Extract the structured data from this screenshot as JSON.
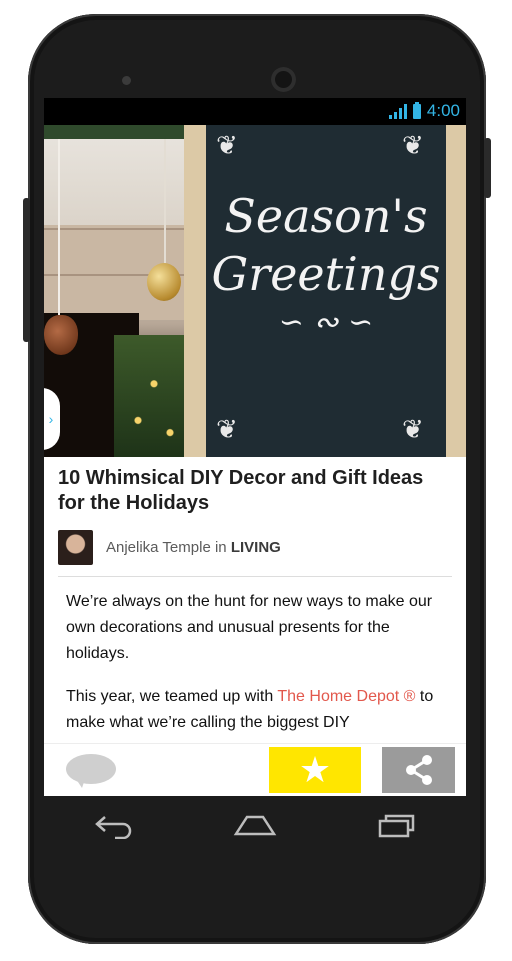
{
  "status_bar": {
    "time": "4:00",
    "signal_icon": "signal-icon",
    "battery_icon": "battery-icon",
    "accent_color": "#33b5e5"
  },
  "hero": {
    "image_text_line1": "Season's",
    "image_text_line2": "Greetings",
    "side_tab_icon": "chevron-right-icon"
  },
  "article": {
    "title": "10 Whimsical DIY Decor and Gift Ideas for the Holidays",
    "author": "Anjelika Temple",
    "in_word": "in",
    "category": "LIVING",
    "paragraph1": "We’re always on the hunt for new ways to make our own decorations and unusual presents for the holidays.",
    "paragraph2_prefix": "This year, we teamed up with ",
    "paragraph2_link": "The Home Depot ®",
    "paragraph2_suffix": " to make what we’re calling the biggest DIY",
    "link_color": "#e2584c"
  },
  "action_bar": {
    "comment_icon": "comment-icon",
    "star_icon": "star-icon",
    "share_icon": "share-icon",
    "star_color": "#ffe600",
    "share_color": "#9b9b9b"
  },
  "nav_bar": {
    "back_icon": "back-icon",
    "home_icon": "home-icon",
    "recents_icon": "recents-icon"
  }
}
